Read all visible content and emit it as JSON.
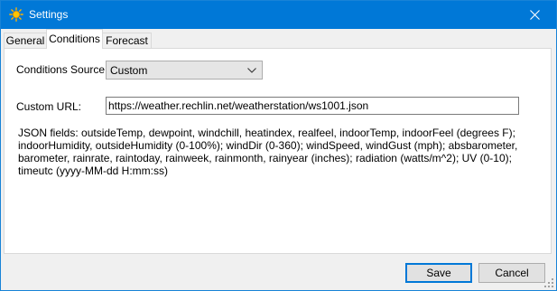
{
  "window": {
    "title": "Settings",
    "accent": "#0078d7"
  },
  "tabs": [
    {
      "label": "General",
      "active": false
    },
    {
      "label": "Conditions",
      "active": true
    },
    {
      "label": "Forecast",
      "active": false
    }
  ],
  "conditions": {
    "source_label": "Conditions Source:",
    "source_value": "Custom",
    "url_label": "Custom URL:",
    "url_value": "https://weather.rechlin.net/weatherstation/ws1001.json",
    "help_text": "JSON fields: outsideTemp, dewpoint, windchill, heatindex, realfeel, indoorTemp, indoorFeel (degrees F); indoorHumidity, outsideHumidity (0-100%); windDir (0-360); windSpeed, windGust (mph); absbarometer, barometer, rainrate, raintoday, rainweek, rainmonth, rainyear (inches); radiation (watts/m^2); UV (0-10); timeutc (yyyy-MM-dd H:mm:ss)"
  },
  "buttons": {
    "save": "Save",
    "cancel": "Cancel"
  },
  "icons": {
    "app": "sun-icon",
    "close": "close-icon",
    "dropdown": "chevron-down-icon",
    "resize": "resize-grip-icon"
  }
}
